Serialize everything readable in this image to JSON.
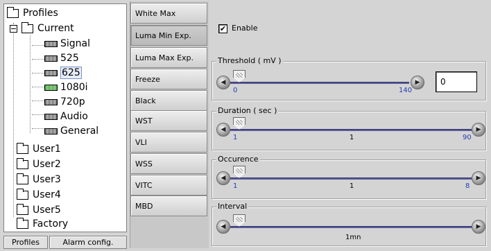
{
  "tree": {
    "root": "Profiles",
    "current": "Current",
    "children": [
      "Signal",
      "525",
      "625",
      "1080i",
      "720p",
      "Audio",
      "General"
    ],
    "users": [
      "User1",
      "User2",
      "User3",
      "User4",
      "User5",
      "Factory"
    ]
  },
  "bottom_buttons": {
    "profiles": "Profiles",
    "alarm_config": "Alarm config."
  },
  "tabs": [
    "White Max",
    "Luma Min Exp.",
    "Luma Max Exp.",
    "Freeze",
    "Black",
    "WST",
    "VLI",
    "WSS",
    "VITC",
    "MBD"
  ],
  "active_tab": "Luma Min Exp.",
  "enable": {
    "label": "Enable",
    "checked": "✔"
  },
  "groups": {
    "threshold": {
      "title": "Threshold ( mV )",
      "min": "0",
      "max": "140",
      "input_value": "0"
    },
    "duration": {
      "title": "Duration ( sec )",
      "min": "1",
      "max": "90",
      "value": "1"
    },
    "occurence": {
      "title": "Occurence",
      "min": "1",
      "max": "8",
      "value": "1"
    },
    "interval": {
      "title": "Interval",
      "value": "1mn"
    }
  },
  "icons": {
    "folder": "folder-icon",
    "card": "card-icon",
    "expand": "collapse-icon",
    "left": "arrow-left-icon",
    "right": "arrow-right-icon",
    "thumb": "slider-thumb-icon"
  }
}
